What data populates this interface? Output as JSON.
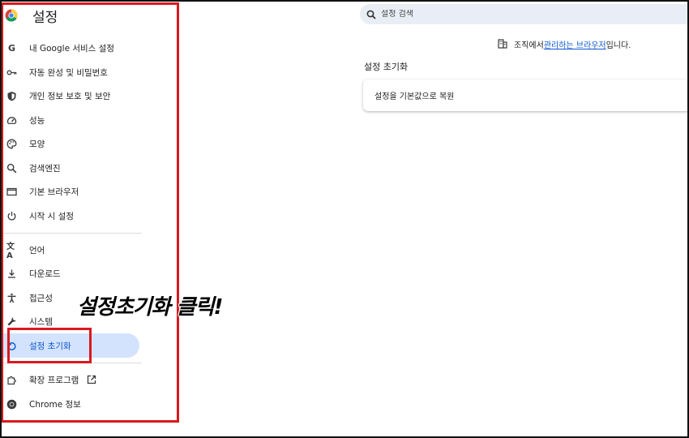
{
  "header": {
    "title": "설정",
    "logo_icon": "chrome-logo-icon"
  },
  "search": {
    "placeholder": "설정 검색",
    "icon": "search-icon"
  },
  "sidebar": {
    "items": [
      {
        "label": "내 Google 서비스 설정",
        "icon": "google-g-icon"
      },
      {
        "label": "자동 완성 및 비밀번호",
        "icon": "key-icon"
      },
      {
        "label": "개인 정보 보호 및 보안",
        "icon": "shield-icon"
      },
      {
        "label": "성능",
        "icon": "speedometer-icon"
      },
      {
        "label": "모양",
        "icon": "palette-icon"
      },
      {
        "label": "검색엔진",
        "icon": "search-icon"
      },
      {
        "label": "기본 브라우저",
        "icon": "browser-window-icon"
      },
      {
        "label": "시작 시 설정",
        "icon": "power-icon"
      },
      {
        "label": "언어",
        "icon": "translate-icon"
      },
      {
        "label": "다운로드",
        "icon": "download-icon"
      },
      {
        "label": "접근성",
        "icon": "accessibility-icon"
      },
      {
        "label": "시스템",
        "icon": "wrench-icon"
      },
      {
        "label": "설정 초기화",
        "icon": "reset-icon",
        "active": true
      },
      {
        "label": "확장 프로그램",
        "icon": "puzzle-icon",
        "external_icon": "open-in-new-icon"
      },
      {
        "label": "Chrome 정보",
        "icon": "chrome-logo-icon"
      }
    ]
  },
  "managed": {
    "prefix": "조직에서 ",
    "link": "관리하는 브라우저",
    "suffix": "입니다.",
    "icon": "building-icon"
  },
  "main": {
    "section_title": "설정 초기화",
    "card_label": "설정을 기본값으로 복원"
  },
  "annotation": {
    "text": "설정초기화 클릭!",
    "color": "#d9191f"
  },
  "colors": {
    "accent": "#0b57d0",
    "active_bg": "#d3e3fd",
    "highlight_red": "#d9191f",
    "search_bg": "#e9eef6"
  }
}
